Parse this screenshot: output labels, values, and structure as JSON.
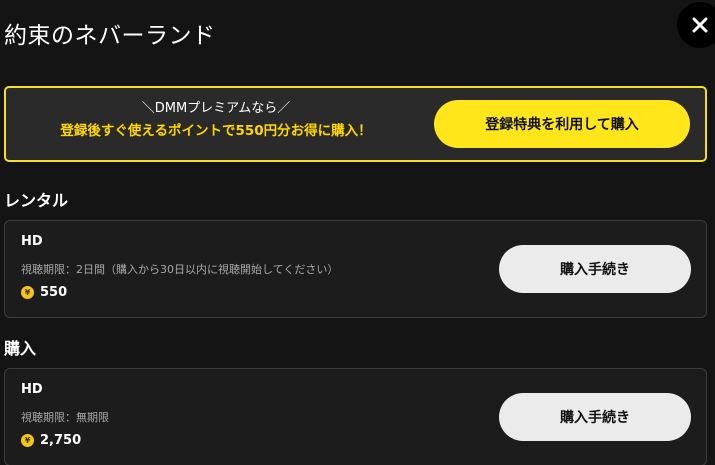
{
  "modal": {
    "title": "約束のネバーランド"
  },
  "promo": {
    "line1": "＼DMMプレミアムなら／",
    "line2": "登録後すぐ使えるポイントで550円分お得に購入！",
    "button_label": "登録特典を利用して購入"
  },
  "rental": {
    "heading": "レンタル",
    "quality": "HD",
    "period": "視聴期限：2日間（購入から30日以内に視聴開始してください）",
    "coin_symbol": "¥",
    "price": "550",
    "button_label": "購入手続き"
  },
  "purchase": {
    "heading": "購入",
    "quality": "HD",
    "period": "視聴期限：無期限",
    "coin_symbol": "¥",
    "price": "2,750",
    "button_label": "購入手続き"
  }
}
